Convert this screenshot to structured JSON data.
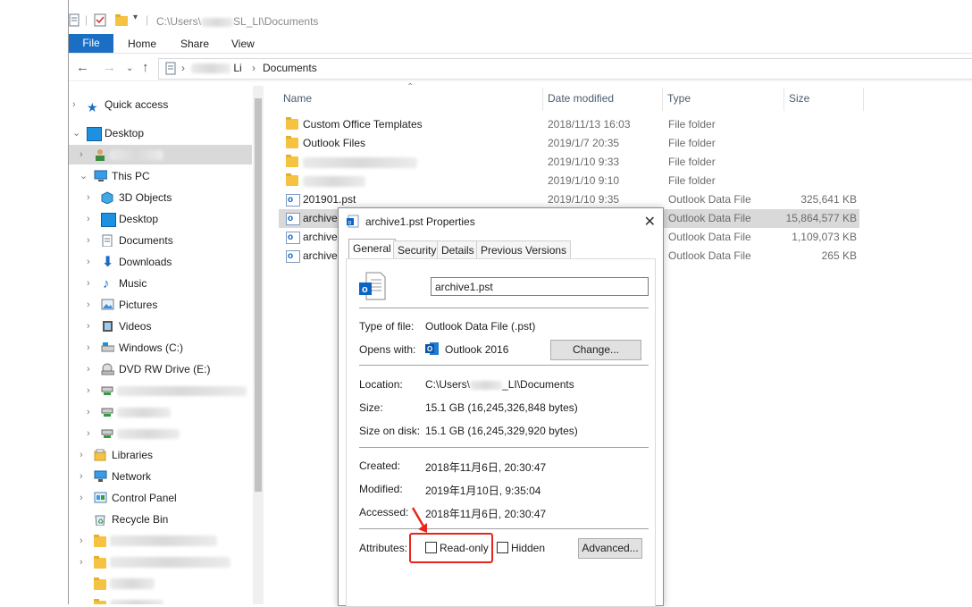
{
  "titlebar": {
    "path_prefix": "C:\\Users\\",
    "path_suffix": "SL_LI\\Documents"
  },
  "ribbon": {
    "tabs": [
      "File",
      "Home",
      "Share",
      "View"
    ]
  },
  "address": {
    "segment_user_suffix": "Li",
    "segment_folder": "Documents"
  },
  "nav_pane": {
    "quick_access": "Quick access",
    "desktop_root": "Desktop",
    "this_pc": "This PC",
    "pc_items": [
      "3D Objects",
      "Desktop",
      "Documents",
      "Downloads",
      "Music",
      "Pictures",
      "Videos",
      "Windows (C:)",
      "DVD RW Drive (E:)"
    ],
    "libraries": "Libraries",
    "network": "Network",
    "control_panel": "Control Panel",
    "recycle_bin": "Recycle Bin"
  },
  "columns": {
    "name": "Name",
    "date": "Date modified",
    "type": "Type",
    "size": "Size"
  },
  "files": [
    {
      "name": "Custom Office Templates",
      "date": "2018/11/13 16:03",
      "type": "File folder",
      "size": "",
      "icon": "folder-icon"
    },
    {
      "name": "Outlook Files",
      "date": "2019/1/7 20:35",
      "type": "File folder",
      "size": "",
      "icon": "folder-icon"
    },
    {
      "name": "",
      "date": "2019/1/10 9:33",
      "type": "File folder",
      "size": "",
      "icon": "folder-icon"
    },
    {
      "name": "",
      "date": "2019/1/10 9:10",
      "type": "File folder",
      "size": "",
      "icon": "folder-icon"
    },
    {
      "name": "201901.pst",
      "date": "2019/1/10 9:35",
      "type": "Outlook Data File",
      "size": "325,641 KB",
      "icon": "outlook-file-icon"
    },
    {
      "name": "archive1",
      "date": "",
      "type": "Outlook Data File",
      "size": "15,864,577 KB",
      "icon": "outlook-file-icon"
    },
    {
      "name": "archive2",
      "date": "",
      "type": "Outlook Data File",
      "size": "1,109,073 KB",
      "icon": "outlook-file-icon"
    },
    {
      "name": "archive0",
      "date": "",
      "type": "Outlook Data File",
      "size": "265 KB",
      "icon": "outlook-file-icon"
    }
  ],
  "dialog": {
    "title": "archive1.pst Properties",
    "tabs": [
      "General",
      "Security",
      "Details",
      "Previous Versions"
    ],
    "file_name": "archive1.pst",
    "type_label": "Type of file:",
    "type_value": "Outlook Data File (.pst)",
    "opens_label": "Opens with:",
    "opens_value": "Outlook 2016",
    "change_button": "Change...",
    "location_label": "Location:",
    "location_prefix": "C:\\Users\\",
    "location_suffix": "_LI\\Documents",
    "size_label": "Size:",
    "size_value": "15.1 GB (16,245,326,848 bytes)",
    "size_disk_label": "Size on disk:",
    "size_disk_value": "15.1 GB (16,245,329,920 bytes)",
    "created_label": "Created:",
    "created_value": "2018年11月6日, 20:30:47",
    "modified_label": "Modified:",
    "modified_value": "2019年1月10日, 9:35:04",
    "accessed_label": "Accessed:",
    "accessed_value": "2018年11月6日, 20:30:47",
    "attributes_label": "Attributes:",
    "readonly_label": "Read-only",
    "hidden_label": "Hidden",
    "readonly_checked": false,
    "hidden_checked": false,
    "advanced_button": "Advanced..."
  },
  "colors": {
    "accent": "#1a6fc4",
    "selection": "#cce8ff",
    "highlight": "#e8251c"
  }
}
